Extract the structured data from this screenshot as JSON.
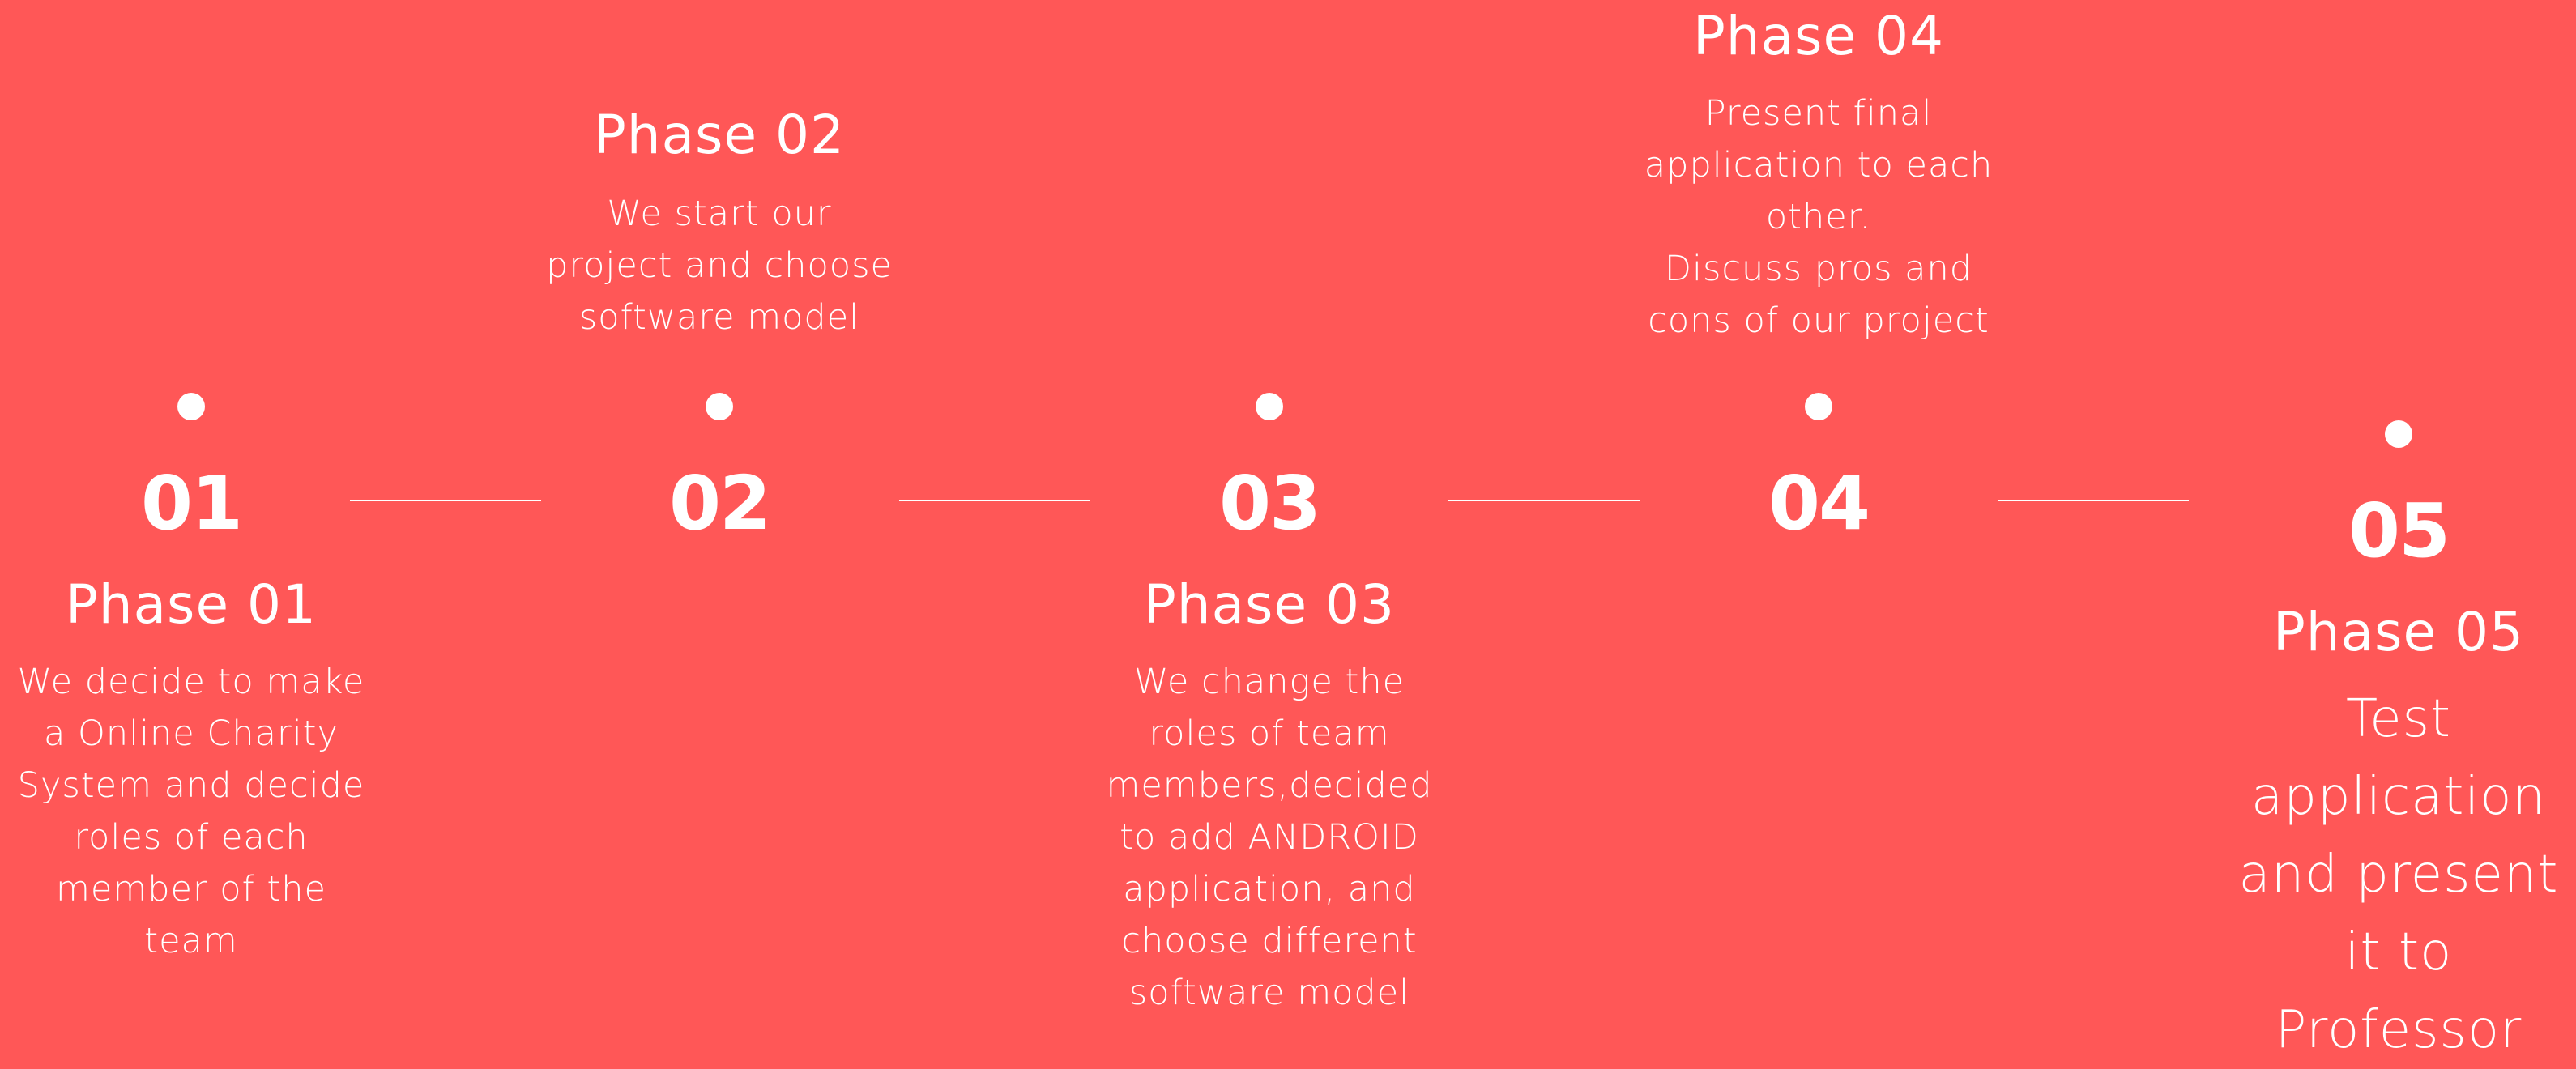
{
  "colors": {
    "background": "#FF5757",
    "foreground": "#FFFFFF"
  },
  "phases": [
    {
      "number": "01",
      "title": "Phase 01",
      "description": "We decide to make\na Online Charity\nSystem and decide\nroles of each\nmember of the\nteam"
    },
    {
      "number": "02",
      "title": "Phase 02",
      "description": "We start our\nproject and choose\nsoftware model"
    },
    {
      "number": "03",
      "title": "Phase 03",
      "description": "We change the\nroles of team\nmembers,decided\nto add ANDROID\napplication, and\nchoose different\nsoftware model"
    },
    {
      "number": "04",
      "title": "Phase 04",
      "description": "Present final\napplication to each\nother.\nDiscuss pros and\ncons of our project"
    },
    {
      "number": "05",
      "title": "Phase 05",
      "description": "Test\napplication\nand present\nit to\nProfessor"
    }
  ]
}
